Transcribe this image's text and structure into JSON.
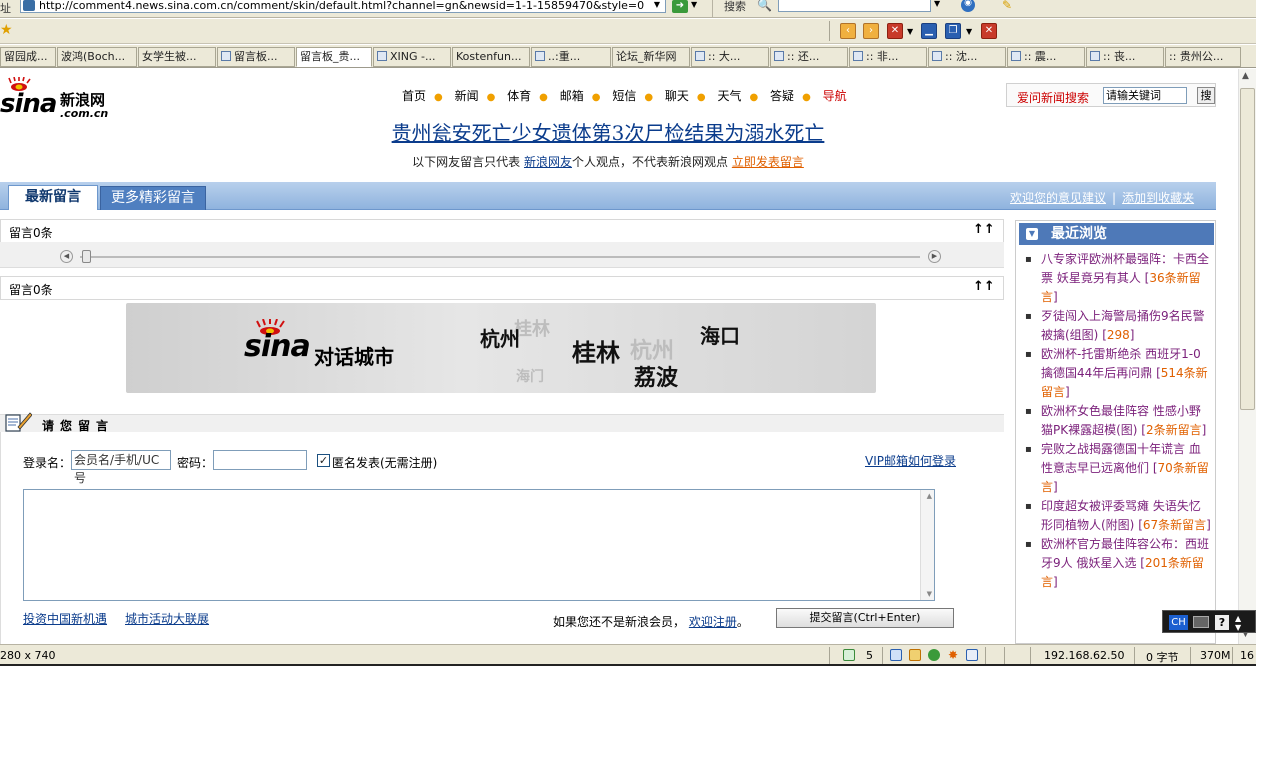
{
  "browser": {
    "address_label": "址",
    "url": "http://comment4.news.sina.com.cn/comment/skin/default.html?channel=gn&newsid=1-1-15859470&style=0",
    "search_label": "搜索",
    "tabs": [
      "留园成...",
      "波鸿(Boch...",
      "女学生被...",
      "留言板...",
      "留言板_贵...",
      "XING -...",
      "Kostenfun...",
      "..:重...",
      "论坛_新华网",
      ":: 大...",
      ":: 还...",
      ":: 非...",
      ":: 沈...",
      ":: 震...",
      ":: 丧...",
      ":: 贵州公..."
    ],
    "active_tab": 4
  },
  "header": {
    "logo_text": "sina",
    "logo_cn": "新浪网",
    "logo_domain": ".com.cn",
    "nav": [
      {
        "label": "首页",
        "color": "#000000"
      },
      {
        "label": "新闻",
        "color": "#000000"
      },
      {
        "label": "体育",
        "color": "#000000"
      },
      {
        "label": "邮箱",
        "color": "#000000"
      },
      {
        "label": "短信",
        "color": "#000000"
      },
      {
        "label": "聊天",
        "color": "#000000"
      },
      {
        "label": "天气",
        "color": "#000000"
      },
      {
        "label": "答疑",
        "color": "#000000"
      },
      {
        "label": "导航",
        "color": "#cc0000"
      }
    ],
    "search_label": "爱问新闻搜索",
    "search_placeholder": "请输关键词",
    "search_button": "搜"
  },
  "article": {
    "headline": "贵州瓮安死亡少女遗体第3次尸检结果为溺水死亡",
    "disclaimer_pre": "以下网友留言只代表",
    "disclaimer_link": "新浪网友",
    "disclaimer_mid": "个人观点，不代表新浪网观点",
    "disclaimer_action": "立即发表留言"
  },
  "tabs_bar": {
    "tab_latest": "最新留言",
    "tab_more": "更多精彩留言",
    "link_feedback": "欢迎您的意见建议",
    "separator": "|",
    "link_favorite": "添加到收藏夹"
  },
  "comments": {
    "count_top": "留言0条",
    "count_bottom": "留言0条",
    "arrows": "↑↑"
  },
  "banner": {
    "logo_text": "sina",
    "title": "对话城市",
    "cities": [
      "杭州",
      "桂林",
      "海口",
      "荔波"
    ],
    "faint_cities": [
      "桂林",
      "杭州",
      "海门"
    ]
  },
  "form": {
    "section_title": "请您留言",
    "login_label": "登录名：",
    "login_value": "会员名/手机/UC号",
    "password_label": "密码：",
    "anonymous_checked": true,
    "anonymous_label": "匿名发表(无需注册)",
    "vip_link": "VIP邮箱如何登录",
    "bottom_link_1": "投资中国新机遇",
    "bottom_link_2": "城市活动大联展",
    "register_pre": "如果您还不是新浪会员，",
    "register_link": "欢迎注册",
    "register_post": "。",
    "submit_label": "提交留言(Ctrl+Enter)"
  },
  "sidebar": {
    "title": "最近浏览",
    "items": [
      {
        "text": "八专家评欧洲杯最强阵：卡西全票 妖星竟另有其人",
        "count": "36条新留言"
      },
      {
        "text": "歹徒闯入上海警局捅伤9名民警被擒(组图)",
        "count": "298"
      },
      {
        "text": "欧洲杯-托雷斯绝杀 西班牙1-0擒德国44年后再问鼎",
        "count": "514条新留言"
      },
      {
        "text": "欧洲杯女色最佳阵容 性感小野猫PK裸露超模(图)",
        "count": "2条新留言"
      },
      {
        "text": "完败之战揭露德国十年谎言 血性意志早已远离他们",
        "count": "70条新留言"
      },
      {
        "text": "印度超女被评委骂瘫 失语失忆形同植物人(附图)",
        "count": "67条新留言"
      },
      {
        "text": "欧洲杯官方最佳阵容公布：西班牙9人 俄妖星入选",
        "count": "201条新留言"
      }
    ]
  },
  "statusbar": {
    "dimensions": "280 x 740",
    "count": "5",
    "ip": "192.168.62.50",
    "bytes": "0 字节",
    "memory": "370M",
    "extra": "16"
  },
  "ime": {
    "lang": "CH",
    "help": "?"
  },
  "colors": {
    "link_blue": "#0b3c8c",
    "accent_orange": "#e06000",
    "nav_red": "#cc0000",
    "bar_blue": "#8fb3de",
    "visited_purple": "#7a1f7a"
  }
}
